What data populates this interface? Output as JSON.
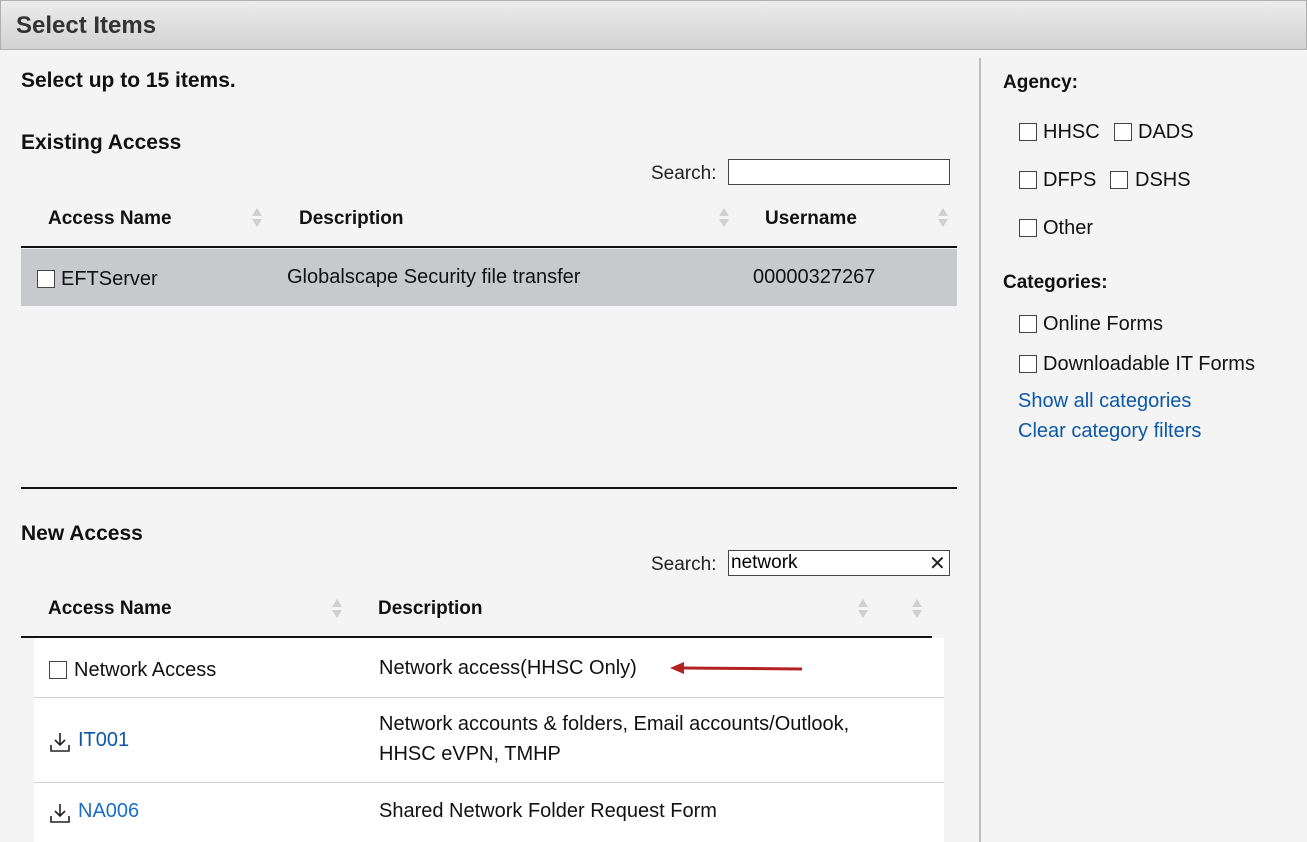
{
  "window": {
    "title": "Select Items"
  },
  "intro": "Select up to 15 items.",
  "existing": {
    "title": "Existing Access",
    "search_label": "Search:",
    "search_value": "",
    "columns": [
      "Access Name",
      "Description",
      "Username"
    ],
    "rows": [
      {
        "name": "EFTServer",
        "description": "Globalscape Security file transfer",
        "username": "00000327267",
        "checked": false
      }
    ]
  },
  "new_access": {
    "title": "New Access",
    "search_label": "Search:",
    "search_value": "network",
    "clear_symbol": "✕",
    "columns": [
      "Access Name",
      "Description"
    ],
    "rows": [
      {
        "name": "Network Access",
        "description": "Network access(HHSC Only)",
        "type": "checkbox",
        "checked": false
      },
      {
        "name": "IT001",
        "description_line1": "Network accounts & folders, Email accounts/Outlook,",
        "description_line2": "HHSC eVPN, TMHP",
        "type": "download-link"
      },
      {
        "name": "NA006",
        "description": "Shared Network Folder Request Form",
        "type": "download-link"
      }
    ],
    "annotation": "red-arrow pointing to Network access(HHSC Only)"
  },
  "filters": {
    "agency_title": "Agency:",
    "agencies": [
      "HHSC",
      "DADS",
      "DFPS",
      "DSHS",
      "Other"
    ],
    "categories_title": "Categories:",
    "categories": [
      "Online Forms",
      "Downloadable IT Forms"
    ],
    "show_all": "Show all categories",
    "clear_filters": "Clear category filters"
  },
  "colors": {
    "link": "#1a6fc4",
    "selected_row": "#c8c9cc",
    "arrow": "#b22222"
  }
}
